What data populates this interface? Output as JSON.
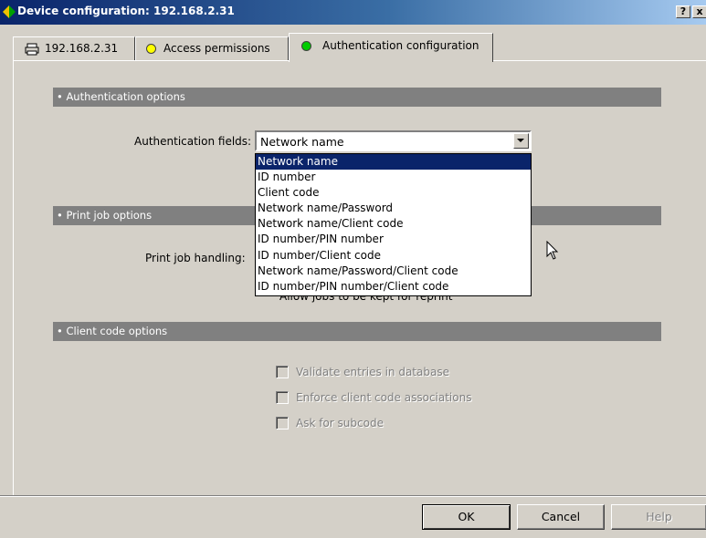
{
  "window": {
    "title": "Device configuration: 192.168.2.31",
    "help_button": "?",
    "close_button": "x"
  },
  "tabs": [
    {
      "label": "192.168.2.31",
      "icon": "printer-icon",
      "active": false
    },
    {
      "label": "Access permissions",
      "icon": "status-circle-yellow",
      "status_color": "#ffff00",
      "active": false
    },
    {
      "label": "Authentication configuration",
      "icon": "status-circle-green",
      "status_color": "#00cc00",
      "active": true
    }
  ],
  "sections": {
    "authentication": {
      "title": "• Authentication options"
    },
    "print_job": {
      "title": "• Print job options"
    },
    "client_code": {
      "title": "• Client code options"
    }
  },
  "auth_fields": {
    "label": "Authentication fields:",
    "value": "Network name",
    "options": [
      "Network name",
      "ID number",
      "Client code",
      "Network name/Password",
      "Network name/Client code",
      "ID number/PIN number",
      "ID number/Client code",
      "Network name/Password/Client code",
      "ID number/PIN number/Client code"
    ],
    "selected_index": 0
  },
  "print_job_handling": {
    "label": "Print job handling:",
    "partially_hidden_option": "Allow jobs to be kept for reprint"
  },
  "client_code_options": [
    {
      "label": "Validate entries in database",
      "checked": false,
      "enabled": false
    },
    {
      "label": "Enforce client code associations",
      "checked": false,
      "enabled": false
    },
    {
      "label": "Ask for subcode",
      "checked": false,
      "enabled": false
    }
  ],
  "buttons": {
    "ok": "OK",
    "cancel": "Cancel",
    "help": "Help"
  },
  "colors": {
    "titlebar_start": "#0a246a",
    "titlebar_end": "#a6caf0",
    "selection": "#0a246a",
    "section_header": "#808080",
    "dialog_bg": "#d4d0c8"
  }
}
